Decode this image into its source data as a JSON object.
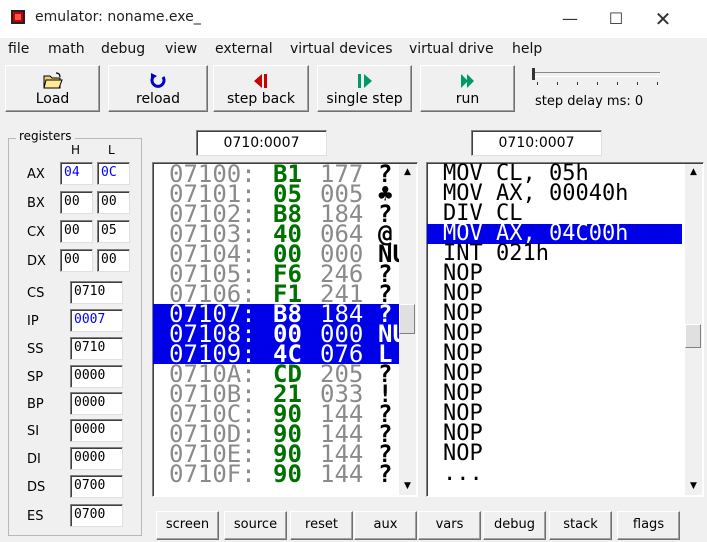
{
  "window": {
    "title": "emulator: noname.exe_"
  },
  "menu": [
    "file",
    "math",
    "debug",
    "view",
    "external",
    "virtual devices",
    "virtual drive",
    "help"
  ],
  "toolbar": {
    "load": "Load",
    "reload": "reload",
    "step_back": "step back",
    "single_step": "single step",
    "run": "run",
    "step_delay": "step delay ms: 0"
  },
  "registers": {
    "legend": "registers",
    "h_header": "H",
    "l_header": "L",
    "AX": {
      "label": "AX",
      "h": "04",
      "l": "0C"
    },
    "BX": {
      "label": "BX",
      "h": "00",
      "l": "00"
    },
    "CX": {
      "label": "CX",
      "h": "00",
      "l": "05"
    },
    "DX": {
      "label": "DX",
      "h": "00",
      "l": "00"
    },
    "CS": {
      "label": "CS",
      "v": "0710"
    },
    "IP": {
      "label": "IP",
      "v": "0007"
    },
    "SS": {
      "label": "SS",
      "v": "0710"
    },
    "SP": {
      "label": "SP",
      "v": "0000"
    },
    "BP": {
      "label": "BP",
      "v": "0000"
    },
    "SI": {
      "label": "SI",
      "v": "0000"
    },
    "DI": {
      "label": "DI",
      "v": "0000"
    },
    "DS": {
      "label": "DS",
      "v": "0700"
    },
    "ES": {
      "label": "ES",
      "v": "0700"
    }
  },
  "memory_address": "0710:0007",
  "disasm_address": "0710:0007",
  "memory_rows": [
    {
      "addr": "07100:",
      "hex": "B1",
      "dec": "177",
      "chr": "?",
      "selected": false
    },
    {
      "addr": "07101:",
      "hex": "05",
      "dec": "005",
      "chr": "♣",
      "selected": false
    },
    {
      "addr": "07102:",
      "hex": "B8",
      "dec": "184",
      "chr": "?",
      "selected": false
    },
    {
      "addr": "07103:",
      "hex": "40",
      "dec": "064",
      "chr": "@",
      "selected": false
    },
    {
      "addr": "07104:",
      "hex": "00",
      "dec": "000",
      "chr": "NU",
      "selected": false
    },
    {
      "addr": "07105:",
      "hex": "F6",
      "dec": "246",
      "chr": "?",
      "selected": false
    },
    {
      "addr": "07106:",
      "hex": "F1",
      "dec": "241",
      "chr": "?",
      "selected": false
    },
    {
      "addr": "07107:",
      "hex": "B8",
      "dec": "184",
      "chr": "?",
      "selected": true
    },
    {
      "addr": "07108:",
      "hex": "00",
      "dec": "000",
      "chr": "NU",
      "selected": true
    },
    {
      "addr": "07109:",
      "hex": "4C",
      "dec": "076",
      "chr": "L",
      "selected": true
    },
    {
      "addr": "0710A:",
      "hex": "CD",
      "dec": "205",
      "chr": "?",
      "selected": false
    },
    {
      "addr": "0710B:",
      "hex": "21",
      "dec": "033",
      "chr": "!",
      "selected": false
    },
    {
      "addr": "0710C:",
      "hex": "90",
      "dec": "144",
      "chr": "?",
      "selected": false
    },
    {
      "addr": "0710D:",
      "hex": "90",
      "dec": "144",
      "chr": "?",
      "selected": false
    },
    {
      "addr": "0710E:",
      "hex": "90",
      "dec": "144",
      "chr": "?",
      "selected": false
    },
    {
      "addr": "0710F:",
      "hex": "90",
      "dec": "144",
      "chr": "?",
      "selected": false
    }
  ],
  "disasm_rows": [
    {
      "text": "MOV CL, 05h",
      "selected": false
    },
    {
      "text": "MOV AX, 00040h",
      "selected": false
    },
    {
      "text": "DIV CL",
      "selected": false
    },
    {
      "text": "MOV AX, 04C00h",
      "selected": true
    },
    {
      "text": "INT 021h",
      "selected": false
    },
    {
      "text": "NOP",
      "selected": false
    },
    {
      "text": "NOP",
      "selected": false
    },
    {
      "text": "NOP",
      "selected": false
    },
    {
      "text": "NOP",
      "selected": false
    },
    {
      "text": "NOP",
      "selected": false
    },
    {
      "text": "NOP",
      "selected": false
    },
    {
      "text": "NOP",
      "selected": false
    },
    {
      "text": "NOP",
      "selected": false
    },
    {
      "text": "NOP",
      "selected": false
    },
    {
      "text": "NOP",
      "selected": false
    },
    {
      "text": "...",
      "selected": false
    }
  ],
  "bottom_buttons": [
    "screen",
    "source",
    "reset",
    "aux",
    "vars",
    "debug",
    "stack",
    "flags"
  ],
  "colors": {
    "selection": "#0000e8",
    "hex": "#007000",
    "addr": "#8a8a8a",
    "ip_text": "#0000ff"
  },
  "icons": {
    "load": "folder-open-icon",
    "reload": "reload-icon",
    "step_back": "step-back-icon",
    "single_step": "single-step-icon",
    "run": "run-icon"
  }
}
